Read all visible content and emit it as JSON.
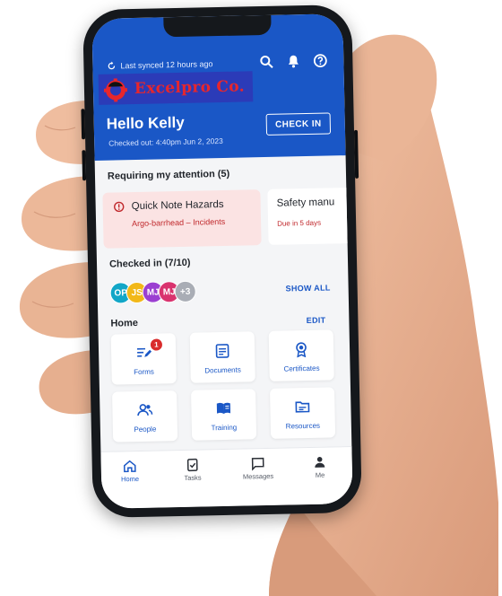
{
  "header": {
    "sync_text": "Last synced 12 hours ago",
    "logo_text": "Excelpro Co.",
    "greeting": "Hello Kelly",
    "checked_out": "Checked out: 4:40pm Jun 2, 2023",
    "checkin_label": "CHECK IN",
    "icons": [
      "search-icon",
      "bell-icon",
      "help-icon"
    ],
    "brand_color": "#1a57c6"
  },
  "attention": {
    "title": "Requiring my attention (5)",
    "cards": [
      {
        "title": "Quick Note Hazards",
        "subtitle": "Argo-barrhead – Incidents"
      },
      {
        "title": "Safety manu",
        "due": "Due in 5 days"
      }
    ]
  },
  "checked_in": {
    "title": "Checked in (7/10)",
    "show_all": "SHOW ALL",
    "avatars": [
      {
        "initials": "OP",
        "color": "#12a6c7"
      },
      {
        "initials": "JS",
        "color": "#f2b818"
      },
      {
        "initials": "MJ",
        "color": "#9b3fd1"
      },
      {
        "initials": "MJ",
        "color": "#d9336e"
      },
      {
        "initials": "+3",
        "color": "#a9adb5"
      }
    ]
  },
  "home": {
    "title": "Home",
    "edit": "EDIT",
    "tiles": [
      {
        "label": "Forms",
        "icon": "form-edit-icon",
        "badge": "1"
      },
      {
        "label": "Documents",
        "icon": "document-icon"
      },
      {
        "label": "Certificates",
        "icon": "certificate-icon"
      },
      {
        "label": "People",
        "icon": "people-icon"
      },
      {
        "label": "Training",
        "icon": "training-book-icon"
      },
      {
        "label": "Resources",
        "icon": "resources-folder-icon"
      }
    ]
  },
  "nav": {
    "items": [
      {
        "label": "Home",
        "icon": "home-icon",
        "active": true
      },
      {
        "label": "Tasks",
        "icon": "tasks-icon"
      },
      {
        "label": "Messages",
        "icon": "messages-icon"
      },
      {
        "label": "Me",
        "icon": "person-icon"
      }
    ]
  }
}
